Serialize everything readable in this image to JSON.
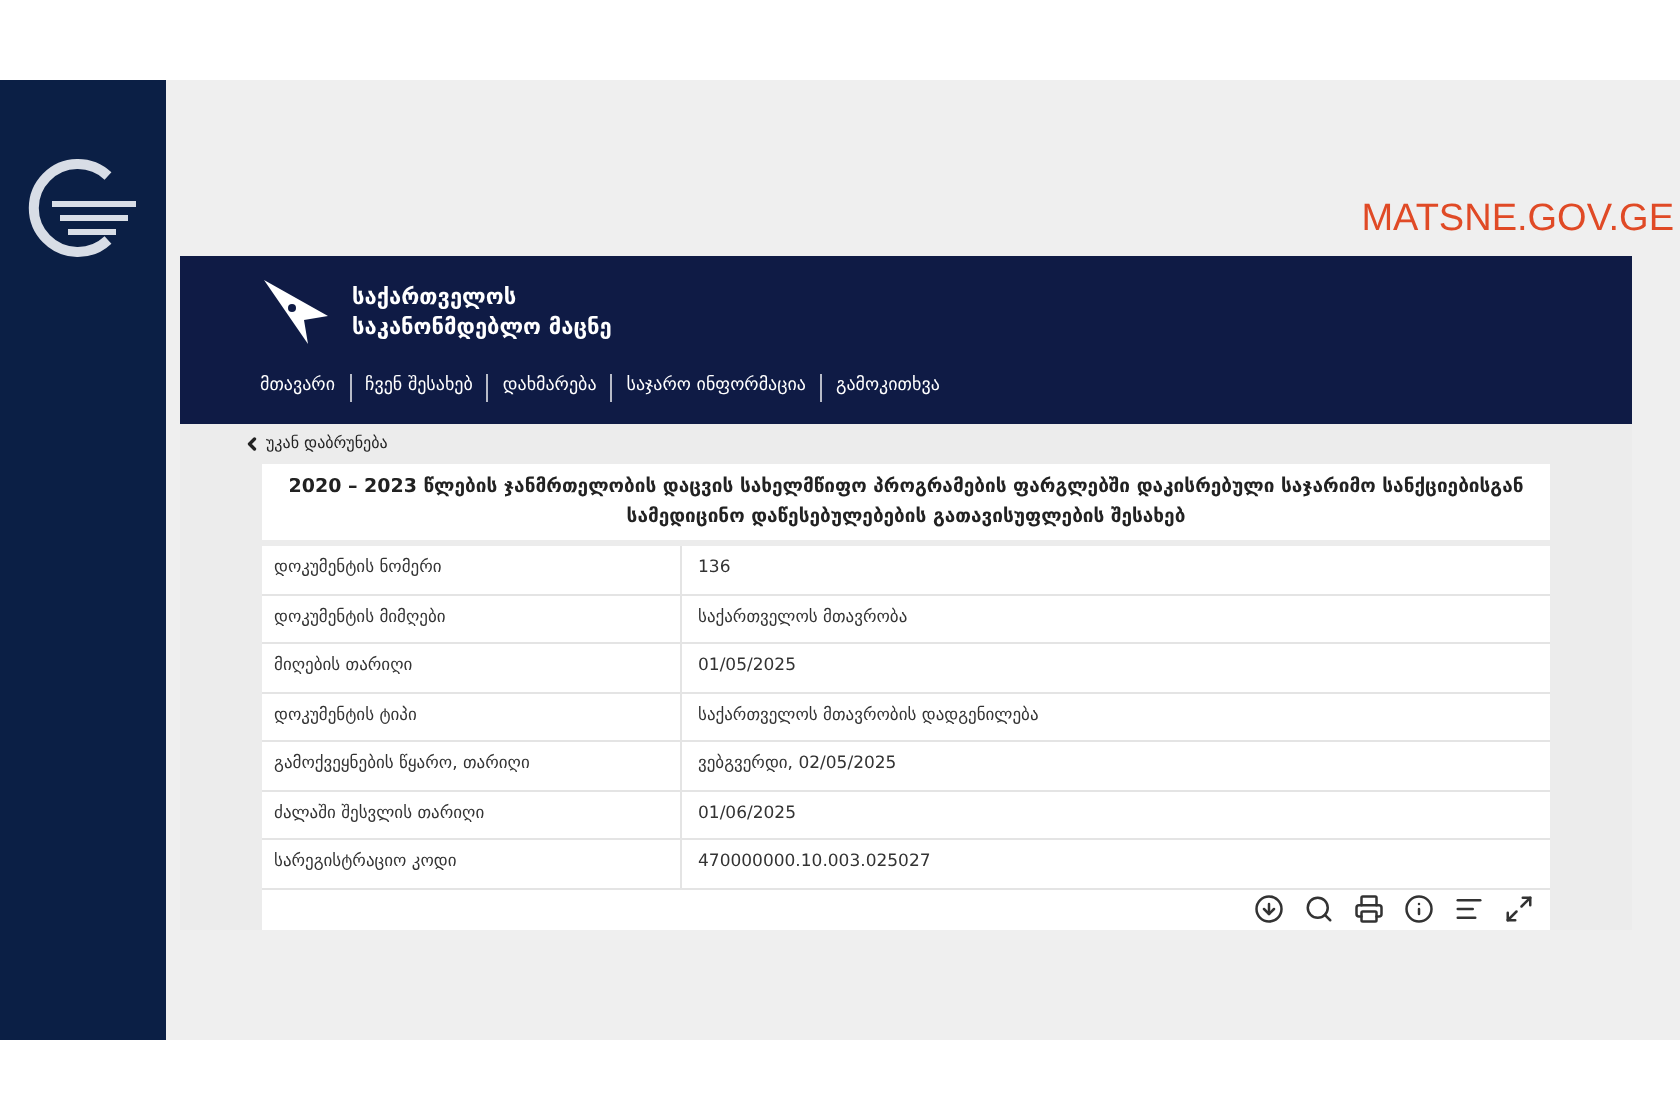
{
  "source_label": "MATSNE.GOV.GE",
  "site": {
    "title_lines": [
      "საქართველოს",
      "საკანონმდებლო მაცნე"
    ],
    "nav": [
      "მთავარი",
      "ჩვენ შესახებ",
      "დახმარება",
      "საჯარო ინფორმაცია",
      "გამოკითხვა"
    ]
  },
  "back_link": "უკან დაბრუნება",
  "document": {
    "title": "2020 – 2023 წლების ჯანმრთელობის დაცვის სახელმწიფო პროგრამების ფარგლებში დაკისრებული საჯარიმო სანქციებისგან სამედიცინო დაწესებულებების გათავისუფლების შესახებ",
    "rows": [
      {
        "label": "დოკუმენტის ნომერი",
        "value": "136"
      },
      {
        "label": "დოკუმენტის მიმღები",
        "value": "საქართველოს მთავრობა"
      },
      {
        "label": "მიღების თარიღი",
        "value": "01/05/2025"
      },
      {
        "label": "დოკუმენტის ტიპი",
        "value": "საქართველოს მთავრობის დადგენილება"
      },
      {
        "label": "გამოქვეყნების წყარო, თარიღი",
        "value": "ვებგვერდი, 02/05/2025"
      },
      {
        "label": "ძალაში შესვლის თარიღი",
        "value": "01/06/2025"
      },
      {
        "label": "სარეგისტრაციო კოდი",
        "value": "470000000.10.003.025027"
      }
    ]
  }
}
